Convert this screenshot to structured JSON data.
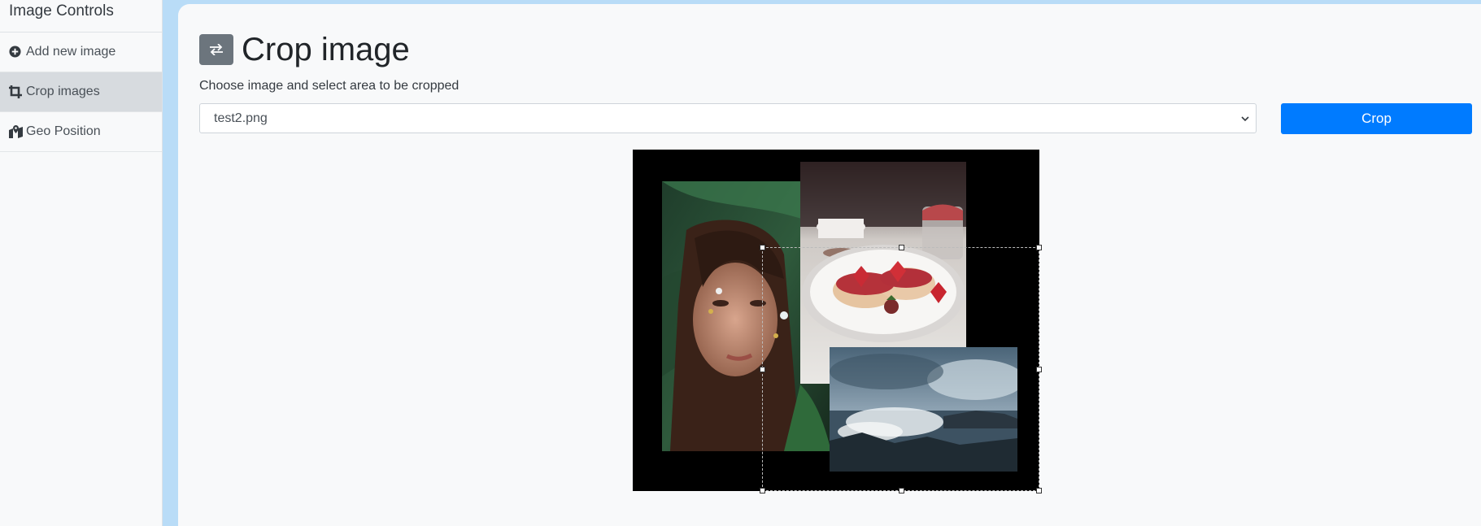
{
  "sidebar": {
    "title": "Image Controls",
    "items": [
      {
        "label": "Add new image",
        "icon": "plus-circle-icon",
        "active": false
      },
      {
        "label": "Crop images",
        "icon": "crop-icon",
        "active": true
      },
      {
        "label": "Geo Position",
        "icon": "map-marker-icon",
        "active": false
      }
    ]
  },
  "main": {
    "title": "Crop image",
    "title_icon": "swap-arrows-icon",
    "subtitle": "Choose image and select area to be cropped",
    "select": {
      "value": "test2.png"
    },
    "crop_label": "Crop"
  },
  "canvas": {
    "images": [
      "portrait-photo",
      "strawberry-plate-photo",
      "stormy-sea-photo"
    ]
  },
  "colors": {
    "accent": "#007bff",
    "sidebar_active": "#d7dbdf",
    "frame": "#b9dcf7"
  }
}
